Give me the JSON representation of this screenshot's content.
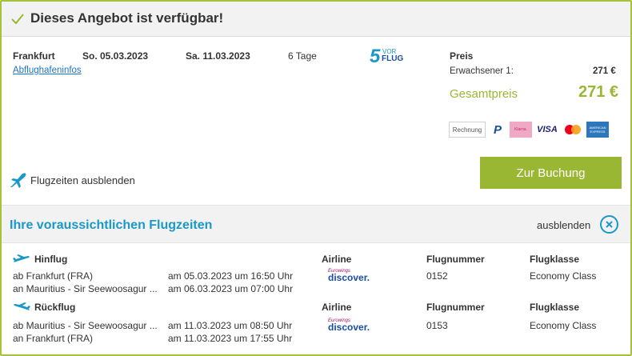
{
  "header": {
    "title": "Dieses Angebot ist verfügbar!"
  },
  "trip": {
    "origin": "Frankfurt",
    "departure": "So. 05.03.2023",
    "return": "Sa. 11.03.2023",
    "duration": "6 Tage",
    "airport_link": "Abflughafeninfos"
  },
  "provider_logo": {
    "num": "5",
    "top": "VOR",
    "bottom": "FLUG"
  },
  "price": {
    "label": "Preis",
    "adult_label": "Erwachsener 1:",
    "adult_value": "271 €",
    "total_label": "Gesamtpreis",
    "total_value": "271 €"
  },
  "payments": [
    "Rechnung",
    "PayPal",
    "Klarna",
    "VISA",
    "Mastercard",
    "AMEX"
  ],
  "payment_texts": {
    "rechnung": "Rechnung",
    "visa": "VISA",
    "amex": "AMERICAN EXPRESS",
    "klarna": "Klarna."
  },
  "toggle": {
    "label": "Flugzeiten ausblenden"
  },
  "booking": {
    "label": "Zur Buchung"
  },
  "flights_section": {
    "title": "Ihre voraussichtlichen Flugzeiten",
    "hide_label": "ausblenden"
  },
  "columns": {
    "airline": "Airline",
    "flight_no": "Flugnummer",
    "class": "Flugklasse"
  },
  "airline_logo": {
    "top": "Eurowings",
    "bottom": "discover."
  },
  "outbound": {
    "label": "Hinflug",
    "from": "ab Frankfurt (FRA)",
    "from_time": "am 05.03.2023 um 16:50 Uhr",
    "to": "an Mauritius - Sir Seewoosagur ...",
    "to_time": "am 06.03.2023 um 07:00 Uhr",
    "flight_no": "0152",
    "class": "Economy Class"
  },
  "inbound": {
    "label": "Rückflug",
    "from": "ab Mauritius - Sir Seewoosagur ...",
    "from_time": "am 11.03.2023 um 08:50 Uhr",
    "to": "an Frankfurt (FRA)",
    "to_time": "am 11.03.2023 um 17:55 Uhr",
    "flight_no": "0153",
    "class": "Economy Class"
  },
  "colors": {
    "accent_green": "#9ab733",
    "accent_blue": "#1a98c7",
    "link": "#1a73c6",
    "border": "#a6c13a"
  }
}
